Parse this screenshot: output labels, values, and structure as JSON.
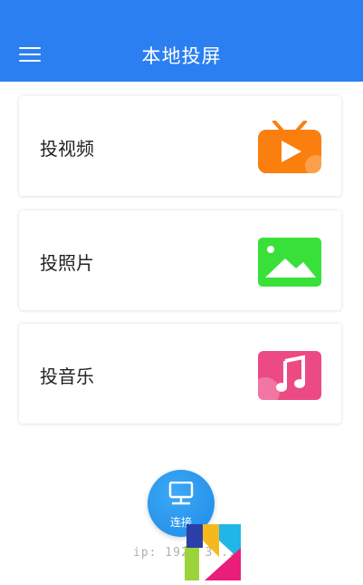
{
  "header": {
    "title": "本地投屏",
    "menu_icon": "menu-icon"
  },
  "cards": [
    {
      "label": "投视频",
      "icon": "tv-play-icon",
      "color": "#fb7f0f"
    },
    {
      "label": "投照片",
      "icon": "image-icon",
      "color": "#3ae03a"
    },
    {
      "label": "投音乐",
      "icon": "music-note-icon",
      "color": "#ec4a83"
    }
  ],
  "connect": {
    "label": "连接",
    "icon": "network-monitor-icon",
    "color": "#2b90ea"
  },
  "footer": {
    "ip_text": "ip: 192.  3  .1"
  },
  "colors": {
    "appbar": "#2b7ff0",
    "accent": "#2b90ea"
  }
}
